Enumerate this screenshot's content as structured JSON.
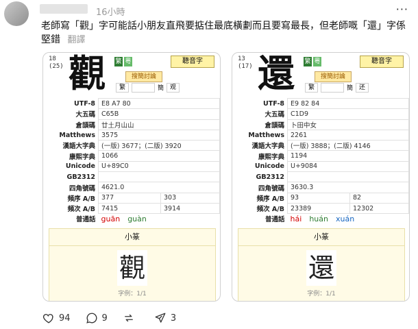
{
  "post": {
    "timestamp": "16小時",
    "text": "老師寫「觀」字可能話小朋友直飛要掂住最底橫劃而且要寫最長，但老師嘅「還」字係堅錯",
    "translate_label": "翻譯"
  },
  "cards": [
    {
      "strokes_top": "18",
      "strokes_bottom": "(25)",
      "char": "觀",
      "icon_a": "繁",
      "icon_b": "粵",
      "audio_label": "聽音字",
      "variant_label": "搜簡討論",
      "trad_label": "繁",
      "simp_label": "簡",
      "simp_char": "观",
      "rows": [
        {
          "label": "UTF-8",
          "value": "E8 A7 80"
        },
        {
          "label": "大五碼",
          "value": "C65B"
        },
        {
          "label": "倉頡碼",
          "value": "廿土月山山"
        },
        {
          "label": "Matthews",
          "value": "3575"
        },
        {
          "label": "漢語大字典",
          "value": "(一版) 3677；(二版) 3920"
        },
        {
          "label": "康熙字典",
          "value": "1066"
        },
        {
          "label": "Unicode",
          "value": "U+89C0"
        },
        {
          "label": "GB2312",
          "value": ""
        },
        {
          "label": "四角號碼",
          "value": "4621.0"
        }
      ],
      "freq_label": "頻序 A/B",
      "freq_a": "377",
      "freq_b": "303",
      "count_label": "頻次 A/B",
      "count_a": "7415",
      "count_b": "3914",
      "mandarin_label": "普通話",
      "pinyin": [
        "guān",
        "guàn"
      ],
      "seal_title": "小篆",
      "seal_char": "觀",
      "seal_footer": "字例：1/1"
    },
    {
      "strokes_top": "13",
      "strokes_bottom": "(17)",
      "char": "還",
      "icon_a": "繁",
      "icon_b": "粵",
      "audio_label": "聽音字",
      "variant_label": "搜簡討論",
      "trad_label": "繁",
      "simp_label": "簡",
      "simp_char": "还",
      "rows": [
        {
          "label": "UTF-8",
          "value": "E9 82 84"
        },
        {
          "label": "大五碼",
          "value": "C1D9"
        },
        {
          "label": "倉頡碼",
          "value": "卜田中女"
        },
        {
          "label": "Matthews",
          "value": "2261"
        },
        {
          "label": "漢語大字典",
          "value": "(一版) 3888；(二版) 4146"
        },
        {
          "label": "康熙字典",
          "value": "1194"
        },
        {
          "label": "Unicode",
          "value": "U+9084"
        },
        {
          "label": "GB2312",
          "value": ""
        },
        {
          "label": "四角號碼",
          "value": "3630.3"
        }
      ],
      "freq_label": "頻序 A/B",
      "freq_a": "93",
      "freq_b": "82",
      "count_label": "頻次 A/B",
      "count_a": "23389",
      "count_b": "12302",
      "mandarin_label": "普通話",
      "pinyin": [
        "hái",
        "huán",
        "xuán"
      ],
      "seal_title": "小篆",
      "seal_char": "還",
      "seal_footer": "字例：1/1"
    }
  ],
  "actions": {
    "likes": "94",
    "comments": "9",
    "reposts": "",
    "shares": "3"
  }
}
